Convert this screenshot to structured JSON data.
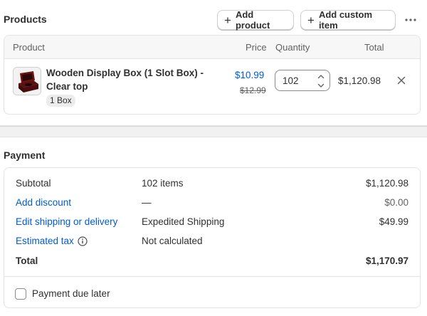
{
  "products": {
    "title": "Products",
    "add_product_label": "Add product",
    "add_custom_item_label": "Add custom item",
    "more_icon": "more-horizontal-icon",
    "columns": {
      "product": "Product",
      "price": "Price",
      "quantity": "Quantity",
      "total": "Total"
    },
    "items": [
      {
        "name": "Wooden Display Box (1 Slot Box) - Clear top",
        "variant": "1 Box",
        "price": "$10.99",
        "original_price": "$12.99",
        "quantity": "102",
        "total": "$1,120.98",
        "remove_icon": "close-icon"
      }
    ]
  },
  "payment": {
    "title": "Payment",
    "subtotal": {
      "label": "Subtotal",
      "detail": "102 items",
      "amount": "$1,120.98"
    },
    "discount": {
      "label": "Add discount",
      "detail": "—",
      "amount": "$0.00"
    },
    "shipping": {
      "label": "Edit shipping or delivery",
      "detail": "Expedited Shipping",
      "amount": "$49.99"
    },
    "tax": {
      "label": "Estimated tax",
      "detail": "Not calculated",
      "info_icon": "info-icon"
    },
    "total": {
      "label": "Total",
      "amount": "$1,170.97"
    },
    "payment_due_later": {
      "label": "Payment due later",
      "checked": false
    }
  },
  "colors": {
    "link": "#005bd3",
    "text": "#303030",
    "muted": "#616161",
    "border": "#e3e3e3"
  }
}
